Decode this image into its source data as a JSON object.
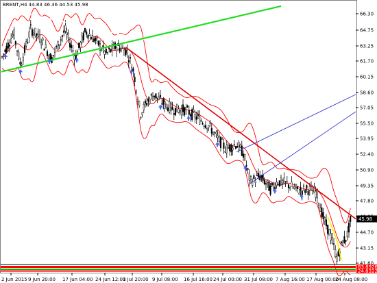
{
  "header": {
    "symbol_line": "BRENT,H4  44.83 46.36 44.53 45.98"
  },
  "chart_data": {
    "type": "candlestick",
    "symbol": "BRENT",
    "timeframe": "H4",
    "ohlc_readout": {
      "open": 44.83,
      "high": 46.36,
      "low": 44.53,
      "close": 45.98
    },
    "last_price_label": "45.98",
    "ylim": [
      40.4,
      67.1
    ],
    "y_ticks": [
      "66.30",
      "64.75",
      "63.25",
      "61.70",
      "60.15",
      "58.60",
      "57.05",
      "55.50",
      "53.95",
      "52.40",
      "50.90",
      "49.35",
      "47.80",
      "46.25",
      "44.70",
      "43.15",
      "41.60"
    ],
    "x_ticks": [
      "2 Jun 2015",
      "9 Jun 20:00",
      "17 Jun 04:00",
      "24 Jun 12:00",
      "1 Jul 20:00",
      "9 Jul 08:00",
      "16 Jul 16:00",
      "24 Jul 00:00",
      "31 Jul 08:00",
      "7 Aug 16:00",
      "17 Aug 00:00",
      "24 Aug 08:00"
    ],
    "indicator_labels": [
      "83.8926",
      "24.8322"
    ],
    "colors": {
      "background": "#ffffff",
      "candle": "#000000",
      "bollinger": "#ff0000",
      "downtrend_line": "#e00000",
      "uptrend_line": "#22dd22",
      "resistance_line": "#ffffff",
      "channel_lines": "#3333cc",
      "fractal_arrows": "#4466ff",
      "highlight_segment": "#ffee00",
      "price_tag": "#000000",
      "indicator_high": "#ff0000",
      "indicator_low": "#00bb00"
    }
  }
}
